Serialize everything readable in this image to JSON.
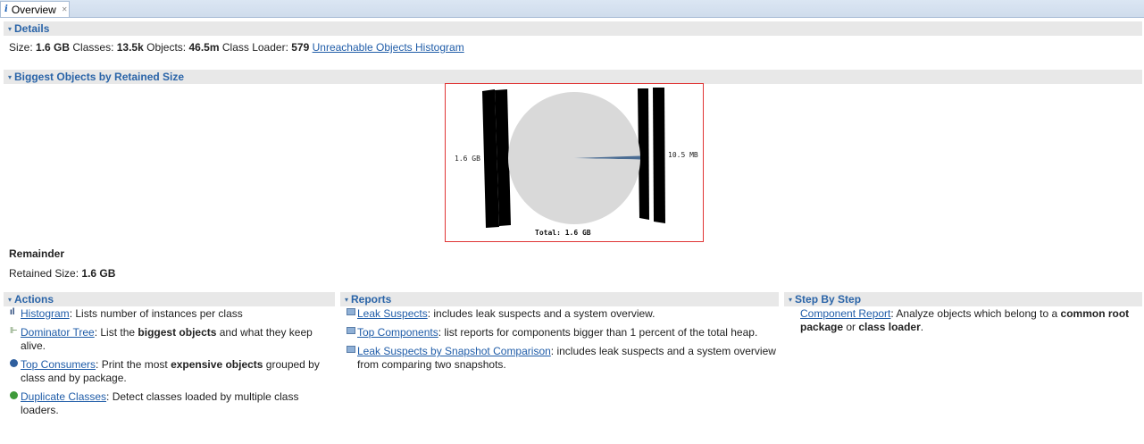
{
  "tab": {
    "icon": "info-icon",
    "label": "Overview",
    "close_icon": "close-icon"
  },
  "details": {
    "section_title": "Details",
    "size_label": "Size:",
    "size_value": "1.6 GB",
    "classes_label": "Classes:",
    "classes_value": "13.5k",
    "objects_label": "Objects:",
    "objects_value": "46.5m",
    "classloader_label": "Class Loader:",
    "classloader_value": "579",
    "histogram_link": "Unreachable Objects Histogram"
  },
  "biggest": {
    "section_title": "Biggest Objects by Retained Size",
    "remainder_title": "Remainder",
    "retained_label": "Retained Size:",
    "retained_value": "1.6 GB"
  },
  "chart_data": {
    "type": "pie",
    "slices": [
      {
        "label": "1.6 GB",
        "value": 1600,
        "color": "#d9d9d9"
      },
      {
        "label": "10.5 MB",
        "value": 10.5,
        "color": "#4a6c93"
      }
    ],
    "total_label": "Total: 1.6 GB"
  },
  "actions": {
    "section_title": "Actions",
    "items": [
      {
        "icon": "histogram-icon",
        "link": "Histogram",
        "text": ": Lists number of instances per class"
      },
      {
        "icon": "dominator-tree-icon",
        "link": "Dominator Tree",
        "text_pre": ": List the ",
        "bold": "biggest objects",
        "text_post": " and what they keep alive."
      },
      {
        "icon": "top-consumers-icon",
        "link": "Top Consumers",
        "text_pre": ": Print the most ",
        "bold": "expensive objects",
        "text_post": " grouped by class and by package."
      },
      {
        "icon": "duplicate-classes-icon",
        "link": "Duplicate Classes",
        "text": ": Detect classes loaded by multiple class loaders."
      }
    ]
  },
  "reports": {
    "section_title": "Reports",
    "items": [
      {
        "icon": "report-icon",
        "link": "Leak Suspects",
        "text": ": includes leak suspects and a system overview."
      },
      {
        "icon": "report-icon",
        "link": "Top Components",
        "text": ": list reports for components bigger than 1 percent of the total heap."
      },
      {
        "icon": "report-icon",
        "link": "Leak Suspects by Snapshot Comparison",
        "text": ": includes leak suspects and a system overview from comparing two snapshots."
      }
    ]
  },
  "stepbystep": {
    "section_title": "Step By Step",
    "link": "Component Report",
    "text_pre": ": Analyze objects which belong to a ",
    "bold1": "common root package",
    "text_mid": " or ",
    "bold2": "class loader",
    "text_post": "."
  }
}
